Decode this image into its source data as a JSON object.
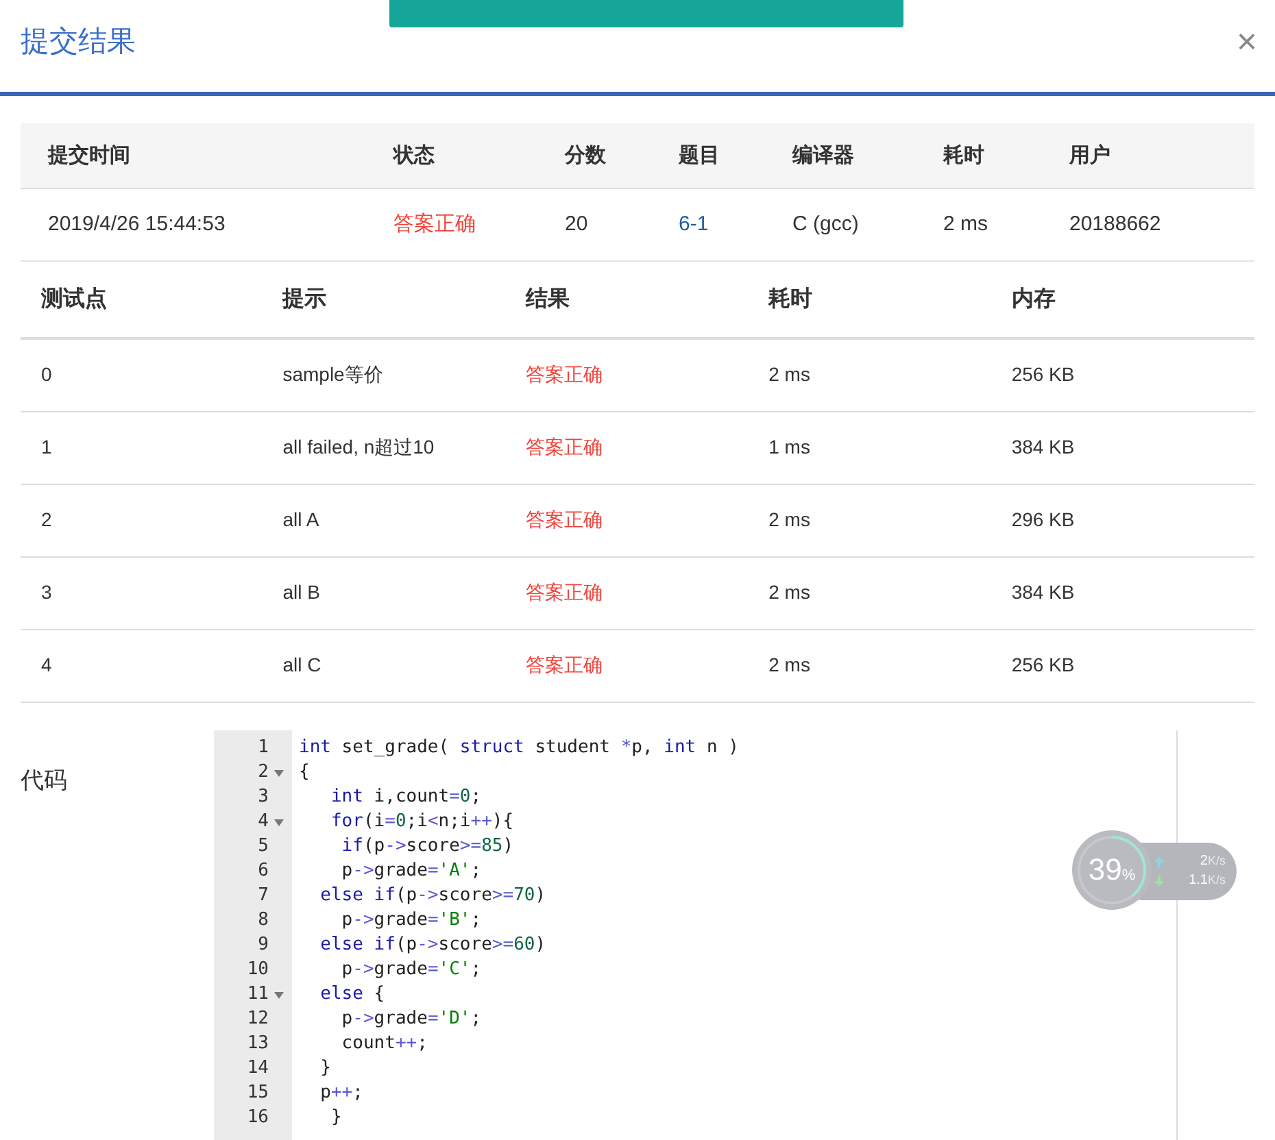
{
  "dialog": {
    "title": "提交结果",
    "close": "×"
  },
  "toast": {
    "visible": true
  },
  "summary": {
    "columns": [
      "提交时间",
      "状态",
      "分数",
      "题目",
      "编译器",
      "耗时",
      "用户"
    ],
    "row": [
      {
        "text": "2019/4/26 15:44:53",
        "kind": "plain"
      },
      {
        "text": "答案正确",
        "kind": "status"
      },
      {
        "text": "20",
        "kind": "plain"
      },
      {
        "text": "6-1",
        "kind": "link"
      },
      {
        "text": "C (gcc)",
        "kind": "plain"
      },
      {
        "text": "2 ms",
        "kind": "plain"
      },
      {
        "text": "20188662",
        "kind": "plain"
      }
    ]
  },
  "tests": {
    "columns": [
      "测试点",
      "提示",
      "结果",
      "耗时",
      "内存"
    ],
    "rows": [
      [
        "0",
        "sample等价",
        "答案正确",
        "2 ms",
        "256 KB"
      ],
      [
        "1",
        "all failed, n超过10",
        "答案正确",
        "1 ms",
        "384 KB"
      ],
      [
        "2",
        "all A",
        "答案正确",
        "2 ms",
        "296 KB"
      ],
      [
        "3",
        "all B",
        "答案正确",
        "2 ms",
        "384 KB"
      ],
      [
        "4",
        "all C",
        "答案正确",
        "2 ms",
        "256 KB"
      ]
    ]
  },
  "code": {
    "label": "代码",
    "lines": [
      {
        "n": "1",
        "fold": false,
        "tokens": [
          {
            "kind": "kw",
            "text": "int"
          },
          {
            "kind": "t",
            "text": " set_grade( "
          },
          {
            "kind": "kw",
            "text": "struct"
          },
          {
            "kind": "t",
            "text": " student "
          },
          {
            "kind": "op",
            "text": "*"
          },
          {
            "kind": "t",
            "text": "p, "
          },
          {
            "kind": "kw",
            "text": "int"
          },
          {
            "kind": "t",
            "text": " n )"
          }
        ]
      },
      {
        "n": "2",
        "fold": true,
        "tokens": [
          {
            "kind": "t",
            "text": "{"
          }
        ]
      },
      {
        "n": "3",
        "fold": false,
        "tokens": [
          {
            "kind": "kw",
            "text": "   int"
          },
          {
            "kind": "t",
            "text": " i,count"
          },
          {
            "kind": "op",
            "text": "="
          },
          {
            "kind": "num",
            "text": "0"
          },
          {
            "kind": "t",
            "text": ";"
          }
        ]
      },
      {
        "n": "4",
        "fold": true,
        "tokens": [
          {
            "kind": "kw",
            "text": "   for"
          },
          {
            "kind": "t",
            "text": "(i"
          },
          {
            "kind": "op",
            "text": "="
          },
          {
            "kind": "num",
            "text": "0"
          },
          {
            "kind": "t",
            "text": ";i"
          },
          {
            "kind": "op",
            "text": "<"
          },
          {
            "kind": "t",
            "text": "n;i"
          },
          {
            "kind": "op",
            "text": "++"
          },
          {
            "kind": "t",
            "text": "){"
          }
        ]
      },
      {
        "n": "5",
        "fold": false,
        "tokens": [
          {
            "kind": "kw",
            "text": "    if"
          },
          {
            "kind": "t",
            "text": "(p"
          },
          {
            "kind": "op",
            "text": "->"
          },
          {
            "kind": "t",
            "text": "score"
          },
          {
            "kind": "op",
            "text": ">="
          },
          {
            "kind": "num",
            "text": "85"
          },
          {
            "kind": "t",
            "text": ")"
          }
        ]
      },
      {
        "n": "6",
        "fold": false,
        "tokens": [
          {
            "kind": "t",
            "text": "    p"
          },
          {
            "kind": "op",
            "text": "->"
          },
          {
            "kind": "t",
            "text": "grade"
          },
          {
            "kind": "op",
            "text": "="
          },
          {
            "kind": "str",
            "text": "'A'"
          },
          {
            "kind": "t",
            "text": ";"
          }
        ]
      },
      {
        "n": "7",
        "fold": false,
        "tokens": [
          {
            "kind": "kw",
            "text": "  else if"
          },
          {
            "kind": "t",
            "text": "(p"
          },
          {
            "kind": "op",
            "text": "->"
          },
          {
            "kind": "t",
            "text": "score"
          },
          {
            "kind": "op",
            "text": ">="
          },
          {
            "kind": "num",
            "text": "70"
          },
          {
            "kind": "t",
            "text": ")"
          }
        ]
      },
      {
        "n": "8",
        "fold": false,
        "tokens": [
          {
            "kind": "t",
            "text": "    p"
          },
          {
            "kind": "op",
            "text": "->"
          },
          {
            "kind": "t",
            "text": "grade"
          },
          {
            "kind": "op",
            "text": "="
          },
          {
            "kind": "str",
            "text": "'B'"
          },
          {
            "kind": "t",
            "text": ";"
          }
        ]
      },
      {
        "n": "9",
        "fold": false,
        "tokens": [
          {
            "kind": "kw",
            "text": "  else if"
          },
          {
            "kind": "t",
            "text": "(p"
          },
          {
            "kind": "op",
            "text": "->"
          },
          {
            "kind": "t",
            "text": "score"
          },
          {
            "kind": "op",
            "text": ">="
          },
          {
            "kind": "num",
            "text": "60"
          },
          {
            "kind": "t",
            "text": ")"
          }
        ]
      },
      {
        "n": "10",
        "fold": false,
        "tokens": [
          {
            "kind": "t",
            "text": "    p"
          },
          {
            "kind": "op",
            "text": "->"
          },
          {
            "kind": "t",
            "text": "grade"
          },
          {
            "kind": "op",
            "text": "="
          },
          {
            "kind": "str",
            "text": "'C'"
          },
          {
            "kind": "t",
            "text": ";"
          }
        ]
      },
      {
        "n": "11",
        "fold": true,
        "tokens": [
          {
            "kind": "kw",
            "text": "  else"
          },
          {
            "kind": "t",
            "text": " {"
          }
        ]
      },
      {
        "n": "12",
        "fold": false,
        "tokens": [
          {
            "kind": "t",
            "text": "    p"
          },
          {
            "kind": "op",
            "text": "->"
          },
          {
            "kind": "t",
            "text": "grade"
          },
          {
            "kind": "op",
            "text": "="
          },
          {
            "kind": "str",
            "text": "'D'"
          },
          {
            "kind": "t",
            "text": ";"
          }
        ]
      },
      {
        "n": "13",
        "fold": false,
        "tokens": [
          {
            "kind": "t",
            "text": "    count"
          },
          {
            "kind": "op",
            "text": "++"
          },
          {
            "kind": "t",
            "text": ";"
          }
        ]
      },
      {
        "n": "14",
        "fold": false,
        "tokens": [
          {
            "kind": "t",
            "text": "  }"
          }
        ]
      },
      {
        "n": "15",
        "fold": false,
        "tokens": [
          {
            "kind": "t",
            "text": "  p"
          },
          {
            "kind": "op",
            "text": "++"
          },
          {
            "kind": "t",
            "text": ";"
          }
        ]
      },
      {
        "n": "16",
        "fold": false,
        "tokens": [
          {
            "kind": "t",
            "text": "   }"
          }
        ]
      }
    ]
  },
  "network_widget": {
    "percent": "39",
    "percent_sign": "%",
    "upload": "2",
    "upload_unit": "K/s",
    "download": "1.1",
    "download_unit": "K/s",
    "level": 0.39
  }
}
